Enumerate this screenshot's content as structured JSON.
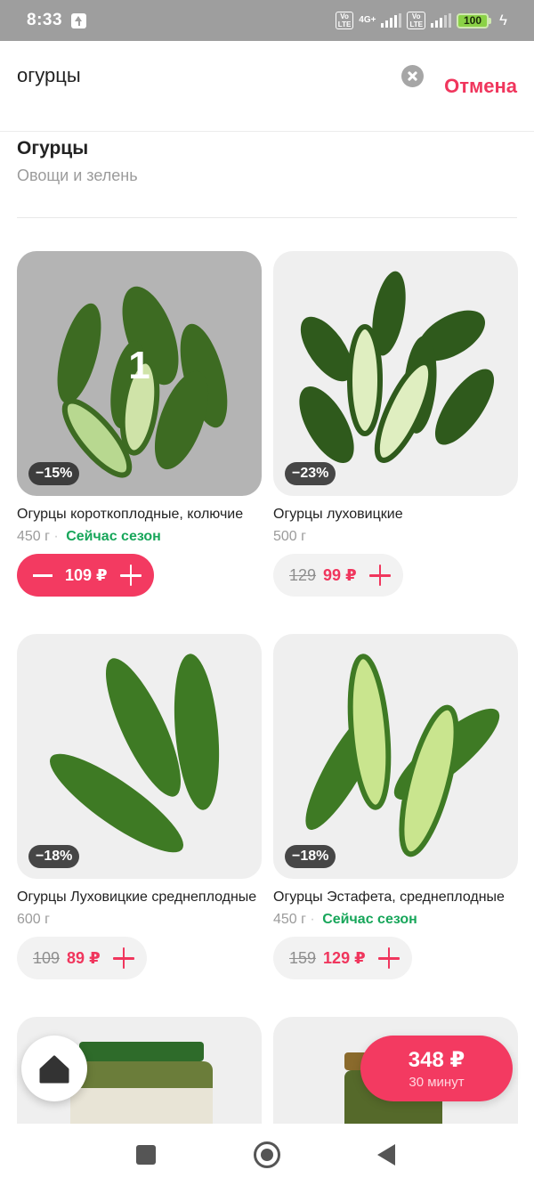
{
  "status_bar": {
    "time": "8:33",
    "volte_label": "Vo LTE",
    "network_label": "4G+",
    "battery": "100"
  },
  "search": {
    "query": "огурцы",
    "cancel_label": "Отмена"
  },
  "category_suggestion": {
    "title": "Огурцы",
    "subtitle": "Овощи и зелень"
  },
  "products": [
    {
      "name": "Огурцы короткоплодные, колючие",
      "weight": "450 г",
      "season": "Сейчас сезон",
      "discount": "−15%",
      "price": "109 ₽",
      "old_price": "",
      "in_cart": "1"
    },
    {
      "name": "Огурцы луховицкие",
      "weight": "500 г",
      "season": "",
      "discount": "−23%",
      "old_price": "129",
      "price": "99 ₽"
    },
    {
      "name": "Огурцы Луховицкие среднеплодные",
      "weight": "600 г",
      "season": "",
      "discount": "−18%",
      "old_price": "109",
      "price": "89 ₽"
    },
    {
      "name": "Огурцы Эстафета, среднеплодные",
      "weight": "450 г",
      "season": "Сейчас сезон",
      "discount": "−18%",
      "old_price": "159",
      "price": "129 ₽"
    }
  ],
  "cart": {
    "total": "348 ₽",
    "delivery_time": "30 минут"
  },
  "icons": {
    "clear": "clear-search-icon",
    "home": "home-icon",
    "plus": "plus-icon",
    "minus": "minus-icon",
    "nav_recent": "recent-apps-icon",
    "nav_home": "system-home-icon",
    "nav_back": "back-icon"
  },
  "colors": {
    "accent": "#f0365d",
    "season_green": "#17a65a",
    "status_bar": "#9e9e9e"
  }
}
